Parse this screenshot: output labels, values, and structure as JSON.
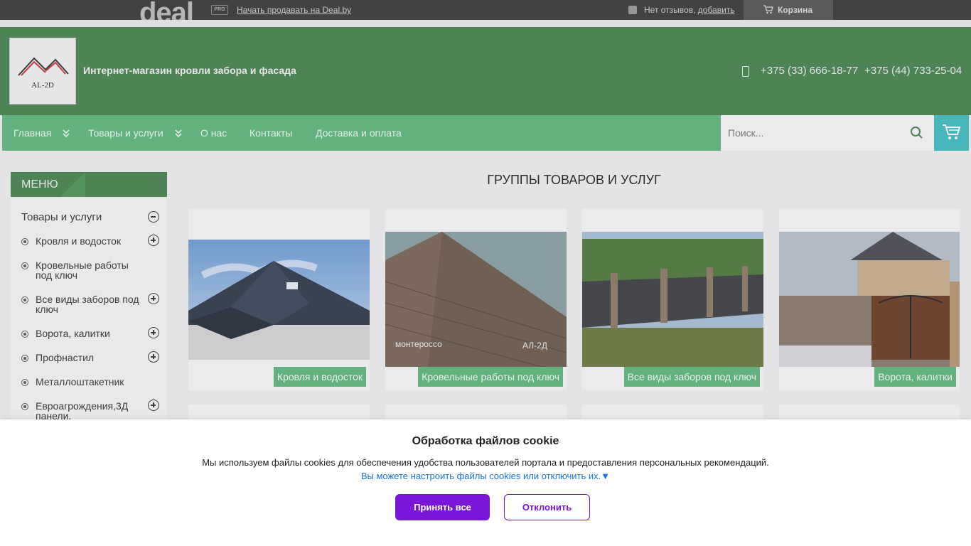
{
  "topbar": {
    "logo": "deal",
    "pro_badge": "PRO",
    "sell_link": "Начать продавать на Deal.by",
    "reviews_text": "Нет отзывов, ",
    "reviews_link": "добавить",
    "cart_label": "Корзина"
  },
  "header": {
    "logo_text": "AL-2D",
    "shop_title": "Интернет-магазин кровли забора и фасада",
    "phones": [
      "+375 (33) 666-18-77",
      "+375 (44) 733-25-04"
    ]
  },
  "nav": {
    "items": [
      {
        "label": "Главная"
      },
      {
        "label": "Товары и услуги"
      },
      {
        "label": "О нас"
      },
      {
        "label": "Контакты"
      },
      {
        "label": "Доставка и оплата"
      }
    ],
    "search_placeholder": "Поиск..."
  },
  "sidebar": {
    "title": "МЕНЮ",
    "root": "Товары и услуги",
    "items": [
      {
        "label": "Кровля и водосток"
      },
      {
        "label": "Кровельные работы под ключ"
      },
      {
        "label": "Все виды заборов под ключ"
      },
      {
        "label": "Ворота, калитки"
      },
      {
        "label": "Профнастил"
      },
      {
        "label": "Металлоштакетник"
      },
      {
        "label": "Евроагрождения,3Д панели."
      }
    ]
  },
  "main": {
    "title": "ГРУППЫ ТОВАРОВ И УСЛУГ",
    "cards": [
      {
        "label": "Кровля и водосток"
      },
      {
        "label": "Кровельные работы под ключ",
        "img_text_left": "монтероссо",
        "img_text_right": "АЛ-2Д"
      },
      {
        "label": "Все виды заборов под ключ"
      },
      {
        "label": "Ворота, калитки"
      }
    ]
  },
  "cookie": {
    "title": "Обработка файлов cookie",
    "text": "Мы используем файлы cookies для обеспечения удобства пользователей портала и предоставления персональных рекомендаций.",
    "link": "Вы можете настроить файлы cookies или отключить их.▼",
    "accept": "Принять все",
    "decline": "Отклонить"
  }
}
